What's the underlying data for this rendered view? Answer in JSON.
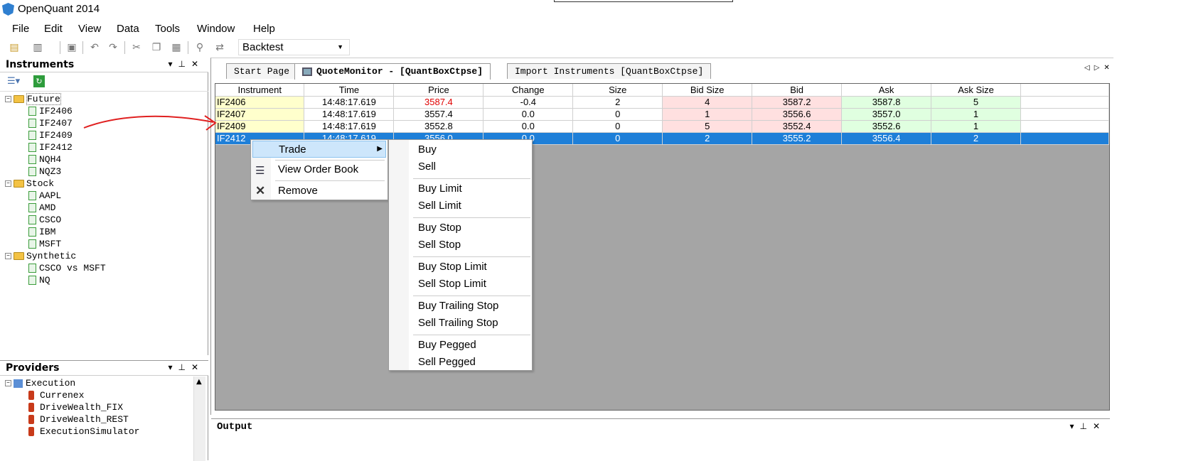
{
  "app": {
    "title": "OpenQuant 2014"
  },
  "menu": [
    "File",
    "Edit",
    "View",
    "Data",
    "Tools",
    "Window",
    "Help"
  ],
  "toolbar": {
    "mode_value": "Backtest"
  },
  "instruments_panel": {
    "title": "Instruments",
    "groups": [
      {
        "label": "Future",
        "items": [
          "IF2406",
          "IF2407",
          "IF2409",
          "IF2412",
          "NQH4",
          "NQZ3"
        ]
      },
      {
        "label": "Stock",
        "items": [
          "AAPL",
          "AMD",
          "CSCO",
          "IBM",
          "MSFT"
        ]
      },
      {
        "label": "Synthetic",
        "items": [
          "CSCO vs MSFT",
          "NQ"
        ]
      }
    ]
  },
  "providers_panel": {
    "title": "Providers",
    "group": "Execution",
    "items": [
      "Currenex",
      "DriveWealth_FIX",
      "DriveWealth_REST",
      "ExecutionSimulator"
    ]
  },
  "tabs": [
    "Start Page",
    "QuoteMonitor - [QuantBoxCtpse]",
    "Import Instruments [QuantBoxCtpse]"
  ],
  "grid": {
    "columns": [
      "Instrument",
      "Time",
      "Price",
      "Change",
      "Size",
      "Bid Size",
      "Bid",
      "Ask",
      "Ask Size"
    ],
    "rows": [
      [
        "IF2406",
        "14:48:17.619",
        "3587.4",
        "-0.4",
        "2",
        "4",
        "3587.2",
        "3587.8",
        "5"
      ],
      [
        "IF2407",
        "14:48:17.619",
        "3557.4",
        "0.0",
        "0",
        "1",
        "3556.6",
        "3557.0",
        "1"
      ],
      [
        "IF2409",
        "14:48:17.619",
        "3552.8",
        "0.0",
        "0",
        "5",
        "3552.4",
        "3552.6",
        "1"
      ],
      [
        "IF2412",
        "14:48:17.619",
        "3556.0",
        "0.0",
        "0",
        "2",
        "3555.2",
        "3556.4",
        "2"
      ]
    ],
    "selected_row": 3
  },
  "context_menu": {
    "items": [
      "Trade",
      "View Order Book",
      "Remove"
    ]
  },
  "trade_submenu": {
    "items": [
      "Buy",
      "Sell",
      "Buy Limit",
      "Sell Limit",
      "Buy Stop",
      "Sell Stop",
      "Buy Stop Limit",
      "Sell Stop Limit",
      "Buy Trailing Stop",
      "Sell Trailing Stop",
      "Buy Pegged",
      "Sell Pegged"
    ]
  },
  "output_panel": {
    "title": "Output"
  },
  "colors": {
    "selection": "#1e7fd8",
    "instrument_bg": "#ffffcc",
    "bid_bg": "#ffe0e0",
    "ask_bg": "#e0ffe0",
    "price_red": "#e00000",
    "annotation_arrow": "#e02020"
  }
}
